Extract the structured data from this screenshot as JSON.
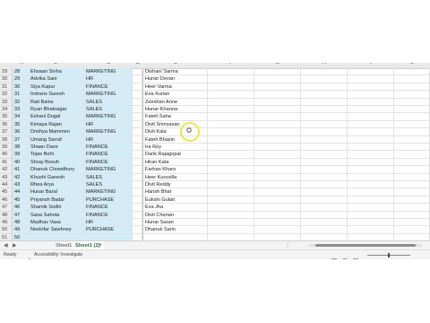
{
  "column_headers": [
    "A",
    "B",
    "C",
    "D",
    "E",
    "F",
    "G",
    "H",
    "I",
    "J"
  ],
  "rows": [
    {
      "num": "29",
      "id": "28",
      "name": "Ehsaan Sinha",
      "dept": "MARKETING",
      "e": "Dishani Sarma"
    },
    {
      "num": "30",
      "id": "29",
      "name": "Advika Sani",
      "dept": "HR",
      "e": "Hunar Devan"
    },
    {
      "num": "31",
      "id": "30",
      "name": "Siya Kapur",
      "dept": "FINANCE",
      "e": "Heer Varma"
    },
    {
      "num": "32",
      "id": "31",
      "name": "Indrans Suresh",
      "dept": "MARKETING",
      "e": "Eva Kurian"
    },
    {
      "num": "33",
      "id": "32",
      "name": "Rati Bains",
      "dept": "SALES",
      "e": "Zeeshan Anne"
    },
    {
      "num": "34",
      "id": "33",
      "name": "Ryan Bhatnagar",
      "dept": "SALES",
      "e": "Hunar Khanna"
    },
    {
      "num": "35",
      "id": "34",
      "name": "Eshani Dugal",
      "dept": "MARKETING",
      "e": "Fateh Saha"
    },
    {
      "num": "36",
      "id": "35",
      "name": "Kimaya Rajan",
      "dept": "HR",
      "e": "Divit Srinivasan"
    },
    {
      "num": "37",
      "id": "36",
      "name": "Drishya Mammen",
      "dept": "MARKETING",
      "e": "Divit Kala"
    },
    {
      "num": "38",
      "id": "37",
      "name": "Umang Sarraf",
      "dept": "HR",
      "e": "Fateh Bhasin"
    },
    {
      "num": "39",
      "id": "38",
      "name": "Shaan Dave",
      "dept": "FINANCE",
      "e": "Ira Roy"
    },
    {
      "num": "40",
      "id": "39",
      "name": "Tejas Behl",
      "dept": "FINANCE",
      "e": "Darik Rajagopal"
    },
    {
      "num": "41",
      "id": "40",
      "name": "Shray Bosuh",
      "dept": "FINANCE",
      "e": "Hiran Kata"
    },
    {
      "num": "42",
      "id": "41",
      "name": "Dhanuk Chowdhury",
      "dept": "MARKETING",
      "e": "Farhan Kharo"
    },
    {
      "num": "43",
      "id": "42",
      "name": "Khushi Ganesh",
      "dept": "SALES",
      "e": "Heer Kuruvilla"
    },
    {
      "num": "44",
      "id": "43",
      "name": "Rhea Arya",
      "dept": "SALES",
      "e": "Divit Reddy"
    },
    {
      "num": "45",
      "id": "44",
      "name": "Hunar Baral",
      "dept": "MARKETING",
      "e": "Harish Bhar"
    },
    {
      "num": "46",
      "id": "45",
      "name": "Priyansh Badal",
      "dept": "PURCHASE",
      "e": "Eukshi Gulati"
    },
    {
      "num": "47",
      "id": "46",
      "name": "Shamik Sodhi",
      "dept": "FINANCE",
      "e": "Eva Jha"
    },
    {
      "num": "48",
      "id": "47",
      "name": "Sana Sahota",
      "dept": "FINANCE",
      "e": "Divit Cherian"
    },
    {
      "num": "49",
      "id": "48",
      "name": "Madhav Vasa",
      "dept": "HR",
      "e": "Hunar Saran"
    },
    {
      "num": "50",
      "id": "49",
      "name": "Neelofar Sawhney",
      "dept": "PURCHASE",
      "e": "Dhanuk Sarin"
    },
    {
      "num": "51",
      "id": "50",
      "name": "",
      "dept": "",
      "e": ""
    }
  ],
  "tabs": {
    "nav_prev": "◀",
    "nav_next": "▶",
    "sheet1": "Sheet1",
    "sheet1_2": "Sheet1 (2)",
    "add": "+",
    "more": "⋮"
  },
  "status": {
    "ready": "Ready",
    "accessibility": "Accessibility: Investigate"
  },
  "colors": {
    "selection_fill": "#d2ecf8",
    "accent_green": "#1e6b3b",
    "cursor_ring": "#f2e24a"
  },
  "icons": [
    "cursor-icon",
    "accessibility-icon",
    "normal-view-icon",
    "page-layout-icon",
    "page-break-icon"
  ]
}
